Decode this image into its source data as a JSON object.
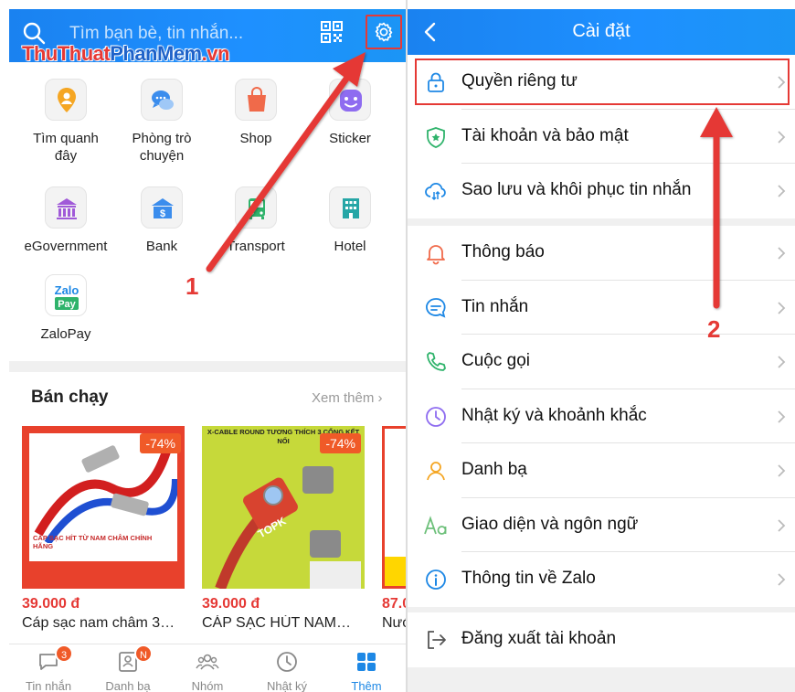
{
  "left": {
    "search_placeholder": "Tìm bạn bè, tin nhắn...",
    "watermark_part1": "ThuThuat",
    "watermark_part2": "PhanMem",
    "watermark_part3": ".vn",
    "apps": [
      {
        "label": "Tìm quanh\nđây",
        "icon": "location-pin-icon",
        "color": "#f5a623"
      },
      {
        "label": "Phòng trò\nchuyện",
        "icon": "chat-bubbles-icon",
        "color": "#3b8ded"
      },
      {
        "label": "Shop",
        "icon": "shopping-bag-icon",
        "color": "#f06a4a"
      },
      {
        "label": "Sticker",
        "icon": "smiley-icon",
        "color": "#8e6cf0"
      },
      {
        "label": "eGovernment",
        "icon": "government-building-icon",
        "color": "#a05ad8"
      },
      {
        "label": "Bank",
        "icon": "bank-icon",
        "color": "#3b8ded"
      },
      {
        "label": "Transport",
        "icon": "bus-icon",
        "color": "#2fb36b"
      },
      {
        "label": "Hotel",
        "icon": "hotel-icon",
        "color": "#26a6a6"
      },
      {
        "label": "ZaloPay",
        "icon": "zalopay-logo-icon",
        "color": "#2fb36b"
      }
    ],
    "section_title": "Bán chạy",
    "see_more": "Xem thêm",
    "products": [
      {
        "discount": "-74%",
        "price": "39.000 đ",
        "name": "Cáp sạc nam châm 3…"
      },
      {
        "discount": "-74%",
        "price": "39.000 đ",
        "name": "CÁP SẠC HÚT NAM…"
      },
      {
        "price": "87.0",
        "name": "Nước"
      }
    ],
    "product1_text": "CÁP SẠC HÍT TỪ NAM CHÂM CHÍNH HÃNG",
    "product2_text": "X-CABLE ROUND TƯƠNG THÍCH 3 CỔNG KẾT NỐI",
    "product2_brand": "TOPK",
    "tabs": [
      {
        "label": "Tin nhắn",
        "badge": "3"
      },
      {
        "label": "Danh bạ",
        "badge": "N"
      },
      {
        "label": "Nhóm",
        "badge": ""
      },
      {
        "label": "Nhật ký",
        "badge": ""
      },
      {
        "label": "Thêm",
        "badge": ""
      }
    ],
    "annotation": "1"
  },
  "right": {
    "title": "Cài đặt",
    "groups": [
      [
        {
          "label": "Quyền riêng tư",
          "icon": "lock-icon"
        },
        {
          "label": "Tài khoản và bảo mật",
          "icon": "shield-icon"
        },
        {
          "label": "Sao lưu và khôi phục tin nhắn",
          "icon": "cloud-sync-icon"
        }
      ],
      [
        {
          "label": "Thông báo",
          "icon": "bell-icon"
        },
        {
          "label": "Tin nhắn",
          "icon": "message-icon"
        },
        {
          "label": "Cuộc gọi",
          "icon": "phone-icon"
        },
        {
          "label": "Nhật ký và khoảnh khắc",
          "icon": "clock-icon"
        },
        {
          "label": "Danh bạ",
          "icon": "contact-icon"
        },
        {
          "label": "Giao diện và ngôn ngữ",
          "icon": "font-aa-icon"
        },
        {
          "label": "Thông tin về Zalo",
          "icon": "info-icon"
        }
      ],
      [
        {
          "label": "Đăng xuất tài khoản",
          "icon": "logout-icon"
        }
      ]
    ],
    "annotation": "2"
  },
  "colors": {
    "brand_blue": "#1e88e5",
    "highlight_red": "#e53935",
    "discount_orange": "#f05a28"
  }
}
